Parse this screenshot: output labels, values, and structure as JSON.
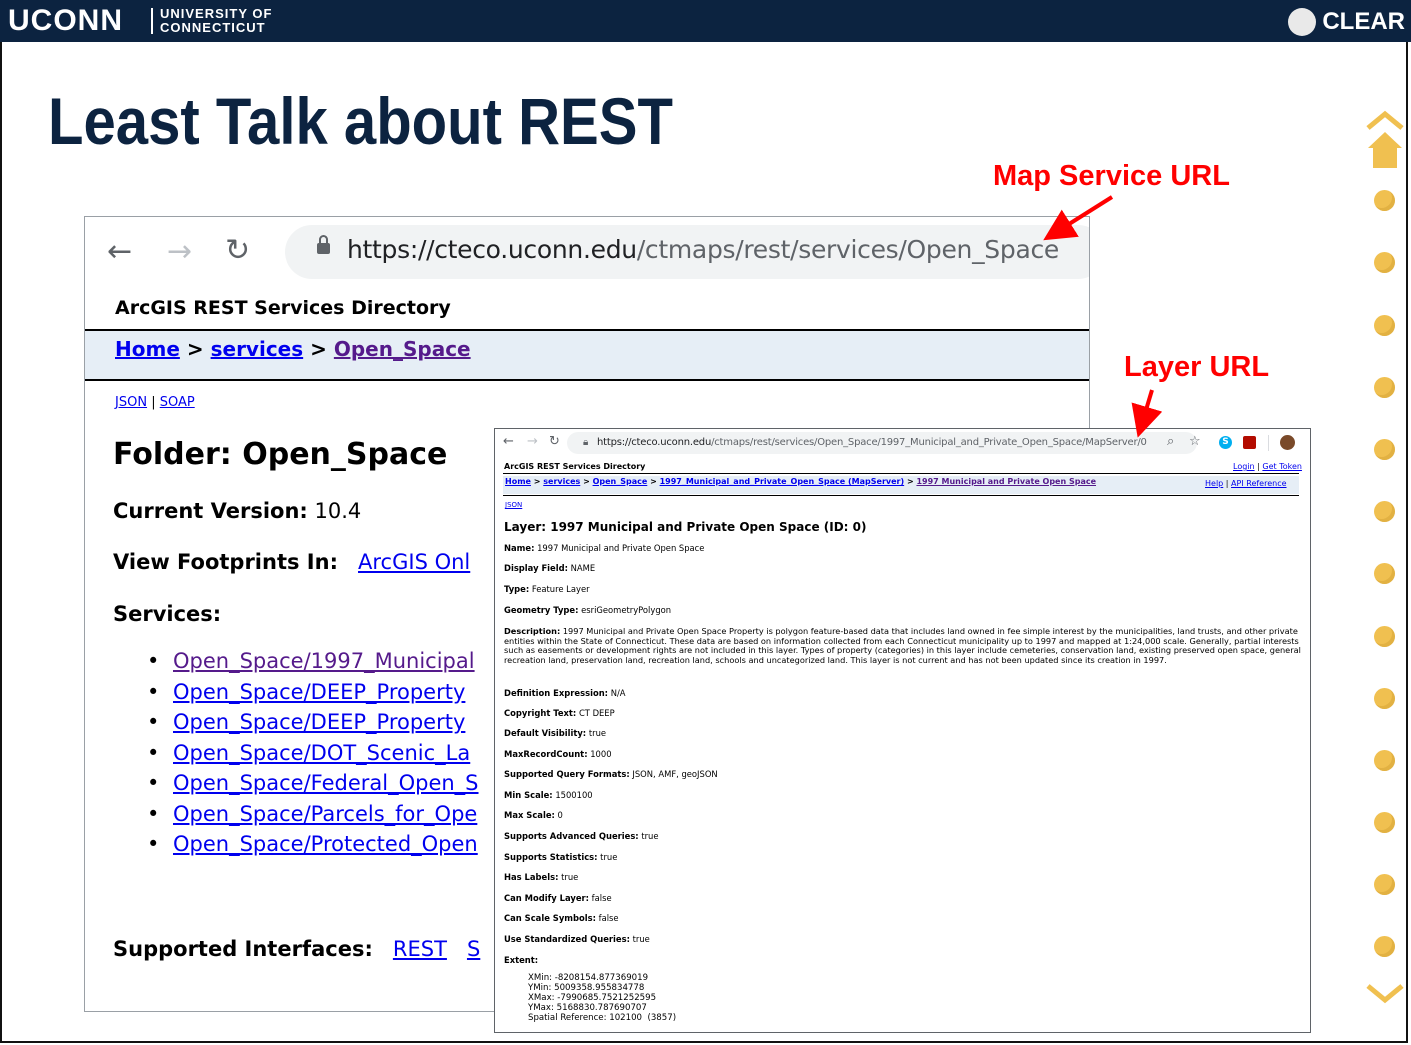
{
  "header": {
    "uconn_logo": "UCONN",
    "uconn_sub_line1": "UNIVERSITY OF",
    "uconn_sub_line2": "CONNECTICUT",
    "clear_logo": "CLEAR"
  },
  "slide": {
    "title": "Least Talk about REST",
    "callout_map_service": "Map Service URL",
    "callout_layer": "Layer URL"
  },
  "browser1": {
    "url_host": "https://cteco.uconn.edu",
    "url_path": "/ctmaps/rest/services/Open_Space",
    "directory_title": "ArcGIS REST Services Directory",
    "breadcrumb": {
      "home": "Home",
      "sep": ">",
      "services": "services",
      "open_space": "Open_Space"
    },
    "json_link": "JSON",
    "pipe": "|",
    "soap_link": "SOAP",
    "folder_title": "Folder: Open_Space",
    "current_version_label": "Current Version:",
    "current_version_value": "10.4",
    "view_footprints_label": "View Footprints In:",
    "view_footprints_link": "ArcGIS Onl",
    "services_label": "Services:",
    "services": [
      "Open_Space/1997_Municipal",
      "Open_Space/DEEP_Property",
      "Open_Space/DEEP_Property",
      "Open_Space/DOT_Scenic_La",
      "Open_Space/Federal_Open_S",
      "Open_Space/Parcels_for_Ope",
      "Open_Space/Protected_Open"
    ],
    "supported_interfaces_label": "Supported Interfaces:",
    "rest_link": "REST",
    "soap_partial": "S"
  },
  "browser2": {
    "url_host": "https://cteco.uconn.edu",
    "url_path": "/ctmaps/rest/services/Open_Space/1997_Municipal_and_Private_Open_Space/MapServer/0",
    "directory_title": "ArcGIS REST Services Directory",
    "login": "Login",
    "get_token": "Get Token",
    "pipe": "|",
    "breadcrumb": {
      "home": "Home",
      "services": "services",
      "open_space": "Open_Space",
      "mapserver": "1997_Municipal_and_Private_Open_Space (MapServer)",
      "layer": "1997 Municipal and Private Open Space",
      "sep": ">"
    },
    "help": "Help",
    "api_reference": "API Reference",
    "json_link": "JSON",
    "layer_title": "Layer: 1997 Municipal and Private Open Space (ID: 0)",
    "fields": [
      {
        "label": "Name:",
        "value": "1997 Municipal and Private Open Space"
      },
      {
        "label": "Display Field:",
        "value": "NAME"
      },
      {
        "label": "Type:",
        "value": "Feature Layer"
      },
      {
        "label": "Geometry Type:",
        "value": "esriGeometryPolygon"
      }
    ],
    "description_label": "Description:",
    "description": "1997 Municipal and Private Open Space Property is polygon feature-based data that includes land owned in fee simple interest by the municipalities, land trusts, and other private entities within the State of Connecticut. These data are based on information collected from each Connecticut municipality up to 1997 and mapped at 1:24,000 scale. Generally, partial interests such as easements or development rights are not included in this layer. Types of property (categories) in this layer include cemeteries, conservation land, existing preserved open space, general recreation land, preservation land, recreation land, schools and uncategorized land. This layer is not current and has not been updated since its creation in 1997.",
    "fields2": [
      {
        "label": "Definition Expression:",
        "value": "N/A"
      },
      {
        "label": "Copyright Text:",
        "value": "CT DEEP"
      },
      {
        "label": "Default Visibility:",
        "value": "true"
      },
      {
        "label": "MaxRecordCount:",
        "value": "1000"
      },
      {
        "label": "Supported Query Formats:",
        "value": "JSON, AMF, geoJSON"
      },
      {
        "label": "Min Scale:",
        "value": "1500100"
      },
      {
        "label": "Max Scale:",
        "value": "0"
      },
      {
        "label": "Supports Advanced Queries:",
        "value": "true"
      },
      {
        "label": "Supports Statistics:",
        "value": "true"
      },
      {
        "label": "Has Labels:",
        "value": "true"
      },
      {
        "label": "Can Modify Layer:",
        "value": "false"
      },
      {
        "label": "Can Scale Symbols:",
        "value": "false"
      },
      {
        "label": "Use Standardized Queries:",
        "value": "true"
      }
    ],
    "extent_label": "Extent:",
    "extent": [
      "XMin: -8208154.877369019",
      "YMin: 5009358.955834778",
      "XMax: -7990685.7521252595",
      "YMax: 5168830.787690707",
      "Spatial Reference: 102100  (3857)"
    ]
  },
  "colors": {
    "uconn_navy": "#0c2340",
    "callout_red": "#ff0000",
    "nav_dot": "#f0c050",
    "breadcrumb_bg": "#e6eef6"
  }
}
